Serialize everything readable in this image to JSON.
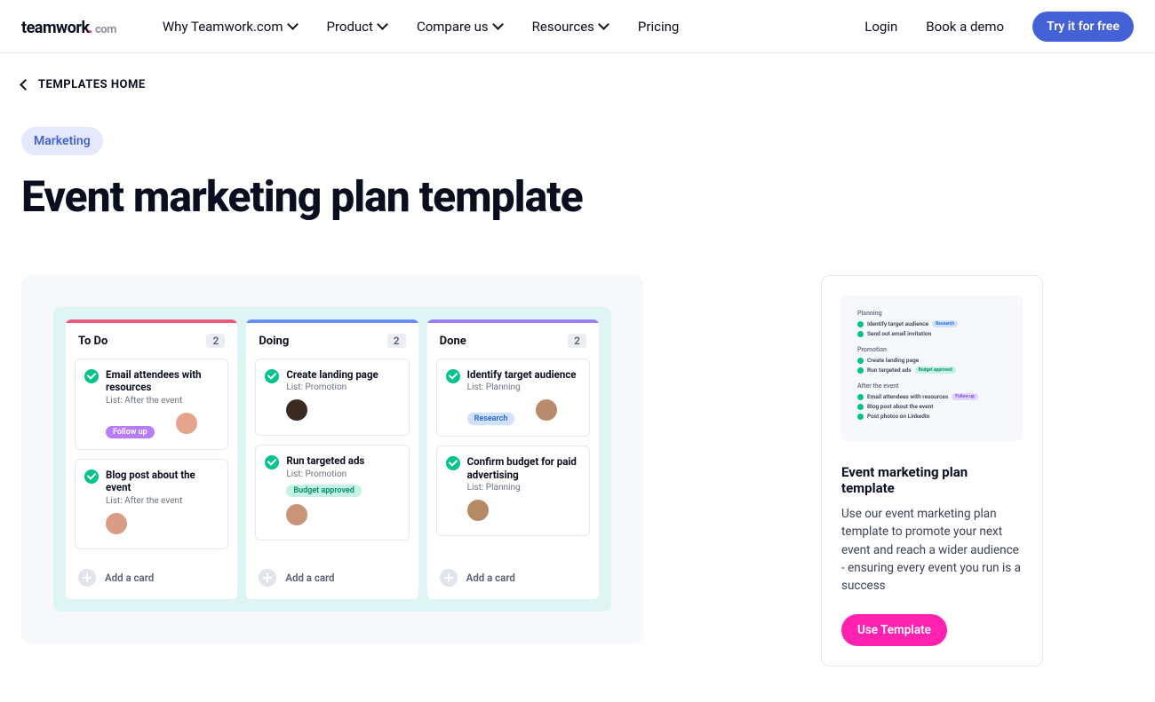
{
  "nav": {
    "logo_main": "teamwork",
    "logo_com": "com",
    "items": [
      "Why Teamwork.com",
      "Product",
      "Compare us",
      "Resources",
      "Pricing"
    ],
    "login": "Login",
    "book": "Book a demo",
    "cta": "Try it for free"
  },
  "breadcrumb": "TEMPLATES HOME",
  "tag": "Marketing",
  "title": "Event marketing plan template",
  "board": {
    "add_label": "Add a card",
    "columns": [
      {
        "title": "To Do",
        "count": "2",
        "strip": "#ee5a7b",
        "cards": [
          {
            "title": "Email attendees with resources",
            "list": "List: After the event",
            "tag": "Follow up",
            "tag_bg": "#b87dff",
            "tag_fg": "#fff",
            "avatar": "#e6a48a"
          },
          {
            "title": "Blog post about the event",
            "list": "List: After the event",
            "avatar": "#d99c84"
          }
        ]
      },
      {
        "title": "Doing",
        "count": "2",
        "strip": "#6a8cf7",
        "cards": [
          {
            "title": "Create landing page",
            "list": "List: Promotion",
            "avatar": "#3b2a20"
          },
          {
            "title": "Run targeted ads",
            "list": "List: Promotion",
            "tag": "Budget approved",
            "tag_bg": "#c2f3e5",
            "tag_fg": "#058a63",
            "avatar": "#c89578"
          }
        ]
      },
      {
        "title": "Done",
        "count": "2",
        "strip": "#9a7df7",
        "cards": [
          {
            "title": "Identify target audience",
            "list": "List: Planning",
            "tag": "Research",
            "tag_bg": "#cfe2ff",
            "tag_fg": "#2a65d9",
            "avatar": "#b88b6c"
          },
          {
            "title": "Confirm budget for paid advertising",
            "list": "List: Planning",
            "avatar": "#b58964"
          }
        ]
      }
    ]
  },
  "side": {
    "thumb": {
      "sections": [
        {
          "label": "Planning",
          "rows": [
            {
              "text": "Identify target audience",
              "tag": "Research",
              "tag_bg": "#cfe2ff",
              "tag_fg": "#2a65d9"
            },
            {
              "text": "Send out email invitation"
            }
          ]
        },
        {
          "label": "Promotion",
          "rows": [
            {
              "text": "Create landing page"
            },
            {
              "text": "Run targeted ads",
              "tag": "Budget approved",
              "tag_bg": "#c2f3e5",
              "tag_fg": "#058a63"
            }
          ]
        },
        {
          "label": "After the event",
          "rows": [
            {
              "text": "Email attendees with resources",
              "tag": "Follow up",
              "tag_bg": "#e3d3ff",
              "tag_fg": "#7a4bd1"
            },
            {
              "text": "Blog post about the event"
            },
            {
              "text": "Post photos on LinkedIn"
            }
          ]
        }
      ]
    },
    "title": "Event marketing plan template",
    "desc": "Use our event marketing plan template to promote your next event and reach a wider audience - ensuring every event you run is a success",
    "button": "Use Template"
  }
}
